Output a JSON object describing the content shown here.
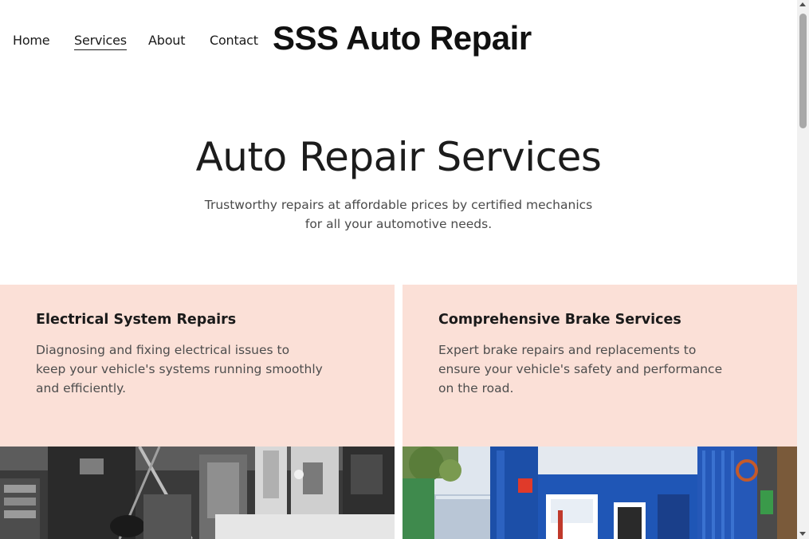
{
  "nav": {
    "items": [
      {
        "label": "Home",
        "active": false
      },
      {
        "label": "Services",
        "active": true
      },
      {
        "label": "About",
        "active": false
      },
      {
        "label": "Contact",
        "active": false
      }
    ],
    "brand": "SSS Auto Repair"
  },
  "hero": {
    "title": "Auto Repair Services",
    "subtitle": "Trustworthy repairs at affordable prices by certified mechanics for all your automotive needs."
  },
  "services": [
    {
      "title": "Electrical System Repairs",
      "description": "Diagnosing and fixing electrical issues to keep your vehicle's systems running smoothly and efficiently.",
      "image": "mechanic-workshop-bw-photo"
    },
    {
      "title": "Comprehensive Brake Services",
      "description": "Expert brake repairs and replacements to ensure your vehicle's safety and performance on the road.",
      "image": "blue-tire-shop-storefront-photo"
    }
  ],
  "colors": {
    "card_background": "#fbe0d7",
    "text_primary": "#1a1a1a",
    "text_secondary": "#4d4d4d"
  }
}
